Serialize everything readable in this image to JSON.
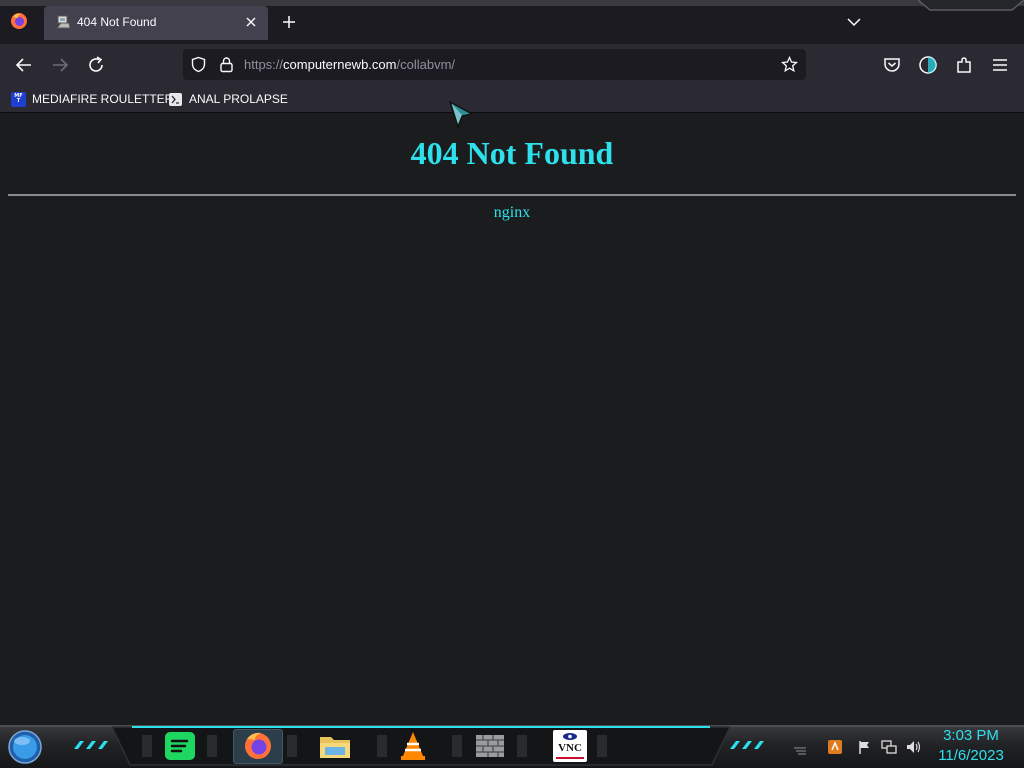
{
  "browser": {
    "tab": {
      "title": "404 Not Found"
    },
    "url": {
      "scheme": "https://",
      "host": "computernewb.com",
      "path": "/collabvm/"
    },
    "bookmarks": [
      {
        "label": "MEDIAFIRE ROULETTER",
        "icon_text": "MFT",
        "icon": "mediafire-icon"
      },
      {
        "label": "ANAL PROLAPSE",
        "icon": "page-icon"
      }
    ]
  },
  "page": {
    "heading": "404 Not Found",
    "server": "nginx"
  },
  "taskbar": {
    "apps": [
      "spotify-icon",
      "firefox-icon",
      "file-explorer-icon",
      "vlc-icon",
      "firewall-icon",
      "vnc-icon"
    ],
    "vnc_label": "VNC",
    "clock": {
      "time": "3:03 PM",
      "date": "11/6/2023"
    }
  },
  "colors": {
    "accent_cyan": "#2ee0ec",
    "page_bg": "#1b1c1e",
    "toolbar_bg": "#2b2a33",
    "tab_bg": "#42414d"
  }
}
